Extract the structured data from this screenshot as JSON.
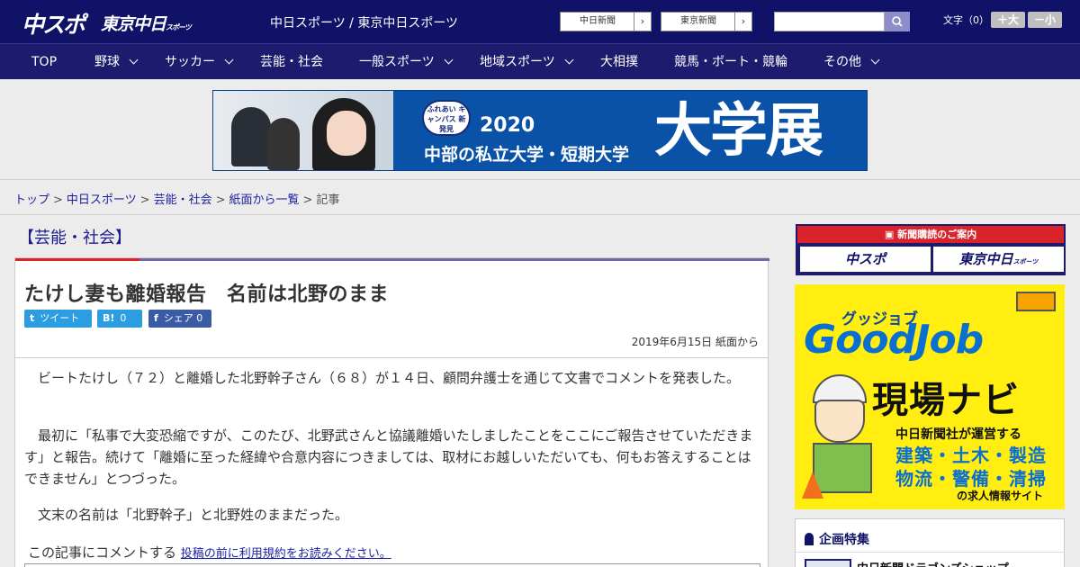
{
  "header": {
    "logo_main": "中スポ",
    "logo_sub": "東京中日",
    "logo_sub_small": "スポーツ",
    "site_names": "中日スポーツ / 東京中日スポーツ",
    "paper_buttons": [
      "中日新聞",
      "東京新聞"
    ],
    "paper_arrow": "›",
    "fontsize_label": "文字（0）",
    "font_up": "＋大",
    "font_down": "－小"
  },
  "nav": {
    "items": [
      "TOP",
      "野球",
      "サッカー",
      "芸能・社会",
      "一般スポーツ",
      "地域スポーツ",
      "大相撲",
      "競馬・ボート・競輪",
      "その他"
    ]
  },
  "banner": {
    "badge": "ふれあい キャンパス 新発見",
    "year": "2020",
    "line2": "中部の私立大学・短期大学",
    "big": "大学展"
  },
  "breadcrumb": {
    "items": [
      "トップ",
      "中日スポーツ",
      "芸能・社会",
      "紙面から一覧",
      "記事"
    ],
    "sep": ">"
  },
  "article": {
    "category": "【芸能・社会】",
    "headline": "たけし妻も離婚報告　名前は北野のまま",
    "share": {
      "tweet_icon": "t",
      "tweet": "ツイート",
      "hatena_icon": "B!",
      "hatena_count": "0",
      "fb_icon": "f",
      "fb": "シェア",
      "fb_count": "0"
    },
    "dateline": "2019年6月15日 紙面から",
    "paragraphs": [
      "　ビートたけし（７２）と離婚した北野幹子さん（６８）が１４日、顧問弁護士を通じて文書でコメントを発表した。",
      "　最初に「私事で大変恐縮ですが、このたび、北野武さんと協議離婚いたしましたことをここにご報告させていただきます」と報告。続けて「離婚に至った経緯や合意内容につきましては、取材にお越しいただいても、何もお答えすることはできません」とつづった。",
      "　文末の名前は「北野幹子」と北野姓のままだった。"
    ],
    "comment_label": "この記事にコメントする",
    "comment_link": "投稿の前に利用規約をお読みください。"
  },
  "sidebar": {
    "subscribe_head": "新聞購読のご案内",
    "subscribe_buttons": [
      "中スポ",
      "東京中日"
    ],
    "subscribe_small": "スポーツ",
    "job_ad": {
      "kana": "グッジョブ",
      "title": "GoodJob",
      "nav": "現場ナビ",
      "line1": "中日新聞社が運営する",
      "line2": "建築・土木・製造",
      "line3": "物流・警備・清掃",
      "line4": "の求人情報サイト"
    },
    "feature_title": "企画特集",
    "feature_item": "中日新聞ドラゴンズショップ"
  }
}
